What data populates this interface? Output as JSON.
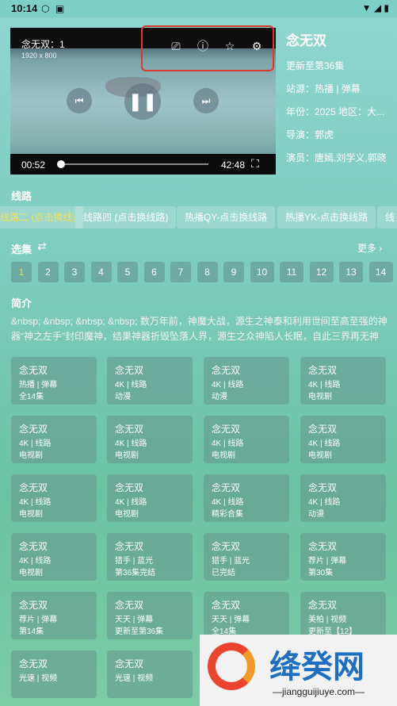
{
  "status_bar": {
    "time": "10:14"
  },
  "player": {
    "title": "念无双：1",
    "resolution": "1920 x 800",
    "current_time": "00:52",
    "duration": "42:48",
    "progress_fraction": 0.02,
    "highlight_color": "#d93a2e"
  },
  "info": {
    "title": "念无双",
    "update": "更新至第36集",
    "source": "站源：热播 | 弹幕",
    "year_area": "年份：2025  地区：大...",
    "director": "导演：郭虎",
    "cast": "演员：唐嫣,刘学义,郭晓"
  },
  "lines_section": {
    "title": "线路",
    "chips": [
      {
        "label": "线路二 (点击换线)",
        "active": true
      },
      {
        "label": "线路四 (点击换线路)",
        "active": false
      },
      {
        "label": "热播QY-点击换线路",
        "active": false
      },
      {
        "label": "热播YK-点击换线路",
        "active": false
      },
      {
        "label": "线",
        "active": false
      }
    ]
  },
  "episodes_section": {
    "title": "选集",
    "more_label": "更多",
    "episodes": [
      "1",
      "2",
      "3",
      "4",
      "5",
      "6",
      "7",
      "8",
      "9",
      "10",
      "11",
      "12",
      "13",
      "14"
    ],
    "active": "1"
  },
  "intro": {
    "title": "简介",
    "text": "&nbsp; &nbsp; &nbsp; &nbsp; 数万年前，神魔大战，源生之神泰和利用世间至高至强的神器“神之左手”封印魔神，结果神器折毁坠落人界，源生之众神陷人长眠，自此三界再无神"
  },
  "cards": [
    {
      "title": "念无双",
      "sub": "热播 | 弹幕",
      "note": "全14集"
    },
    {
      "title": "念无双",
      "sub": "4K | 线路",
      "note": "动漫"
    },
    {
      "title": "念无双",
      "sub": "4K | 线路",
      "note": "动漫"
    },
    {
      "title": "念无双",
      "sub": "4K | 线路",
      "note": "电视剧"
    },
    {
      "title": "念无双",
      "sub": "4K | 线路",
      "note": "电视剧"
    },
    {
      "title": "念无双",
      "sub": "4K | 线路",
      "note": "电视剧"
    },
    {
      "title": "念无双",
      "sub": "4K | 线路",
      "note": "电视剧"
    },
    {
      "title": "念无双",
      "sub": "4K | 线路",
      "note": "电视剧"
    },
    {
      "title": "念无双",
      "sub": "4K | 线路",
      "note": "电视剧"
    },
    {
      "title": "念无双",
      "sub": "4K | 线路",
      "note": "电视剧"
    },
    {
      "title": "念无双",
      "sub": "4K | 线路",
      "note": "精彩合集"
    },
    {
      "title": "念无双",
      "sub": "4K | 线路",
      "note": "动漫"
    },
    {
      "title": "念无双",
      "sub": "4K | 线路",
      "note": "电视剧"
    },
    {
      "title": "念无双",
      "sub": "猎手 | 蓝光",
      "note": "第36集完结"
    },
    {
      "title": "念无双",
      "sub": "猎手 | 蓝光",
      "note": "已完结"
    },
    {
      "title": "念无双",
      "sub": "荐片 | 弹幕",
      "note": "第30集"
    },
    {
      "title": "念无双",
      "sub": "荐片 | 弹幕",
      "note": "第14集"
    },
    {
      "title": "念无双",
      "sub": "天天 | 弹幕",
      "note": "更新至第36集"
    },
    {
      "title": "念无双",
      "sub": "天天 | 弹幕",
      "note": "全14集"
    },
    {
      "title": "念无双",
      "sub": "美柏 | 视频",
      "note": "更新至【12】"
    },
    {
      "title": "念无双",
      "sub": "光速 | 视频",
      "note": ""
    },
    {
      "title": "念无双",
      "sub": "光速 | 视频",
      "note": ""
    }
  ],
  "watermark": {
    "name": "绛癸网",
    "url": "jiangguijiuye.com"
  }
}
